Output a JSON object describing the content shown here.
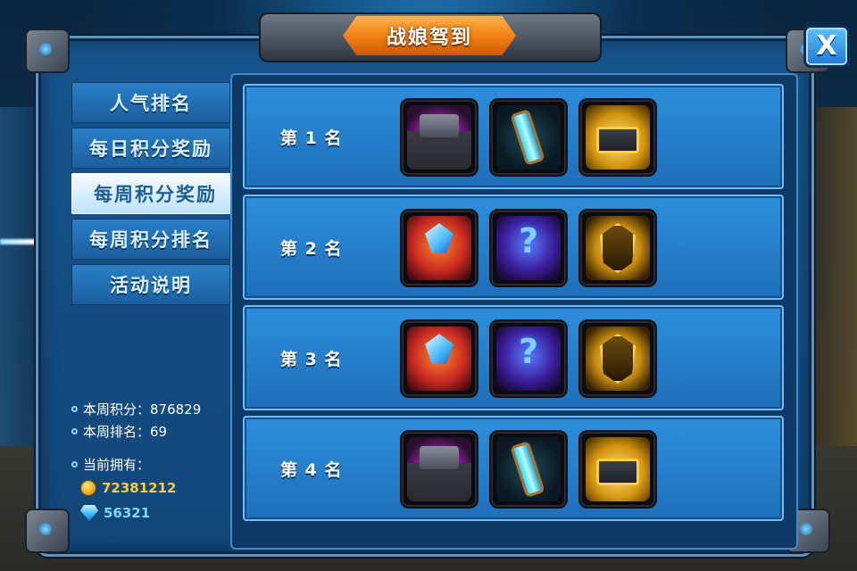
{
  "title": "战娘驾到",
  "close_label": "X",
  "tabs": [
    {
      "label": "人气排名",
      "active": false
    },
    {
      "label": "每日积分奖励",
      "active": false
    },
    {
      "label": "每周积分奖励",
      "active": true
    },
    {
      "label": "每周积分排名",
      "active": false
    },
    {
      "label": "活动说明",
      "active": false
    }
  ],
  "info": {
    "weekly_points": "本周积分：876829",
    "weekly_rank": "本周排名：69",
    "owned_label": "当前拥有：",
    "gold": "72381212",
    "diamonds": "56321"
  },
  "rewards": [
    {
      "rank": "第 1 名",
      "items": [
        "purple-crate",
        "energy-tube",
        "gold-chest"
      ]
    },
    {
      "rank": "第 2 名",
      "items": [
        "crystal-box",
        "mystery-box",
        "gold-armor"
      ]
    },
    {
      "rank": "第 3 名",
      "items": [
        "crystal-box",
        "mystery-box",
        "gold-armor"
      ]
    },
    {
      "rank": "第 4 名",
      "items": [
        "purple-crate",
        "energy-tube",
        "gold-chest"
      ]
    }
  ],
  "colors": {
    "panel_blue": "#1d6fba",
    "title_orange": "#f07d12",
    "active_tab": "#bde3fb",
    "gold_text": "#ffcc33",
    "gem_text": "#7fd6ff"
  }
}
